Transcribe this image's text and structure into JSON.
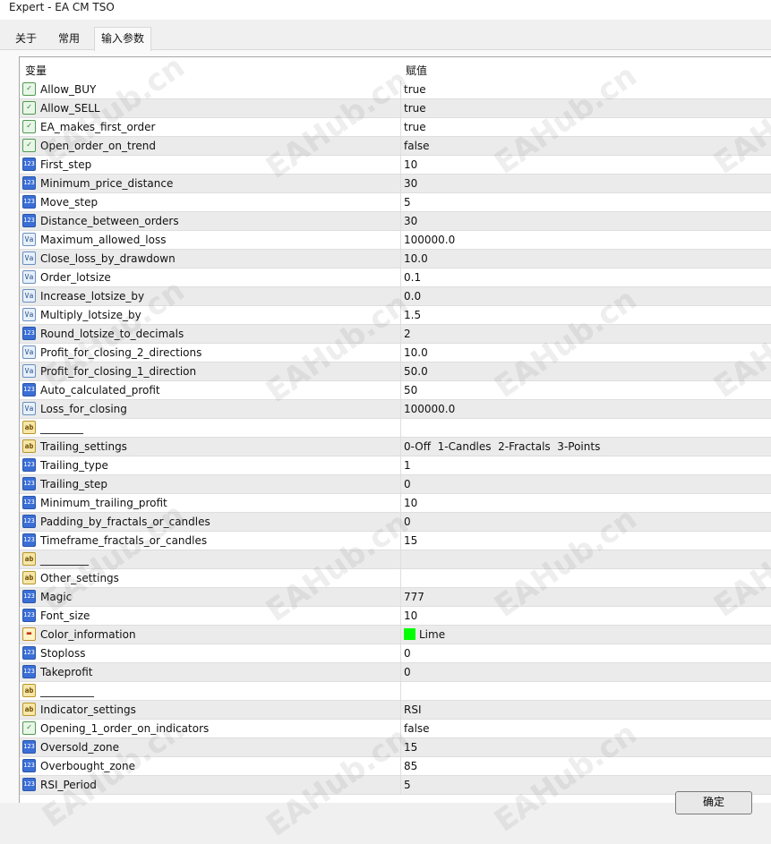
{
  "window": {
    "title": "Expert - EA CM TSO"
  },
  "tabs": [
    {
      "label": "关于",
      "active": false
    },
    {
      "label": "常用",
      "active": false
    },
    {
      "label": "输入参数",
      "active": true
    }
  ],
  "table": {
    "columns": {
      "variable": "变量",
      "value": "赋值"
    },
    "rows": [
      {
        "icon": "bool-icon",
        "type": "bool",
        "name": "Allow_BUY",
        "value": "true"
      },
      {
        "icon": "bool-icon",
        "type": "bool",
        "name": "Allow_SELL",
        "value": "true"
      },
      {
        "icon": "bool-icon",
        "type": "bool",
        "name": "EA_makes_first_order",
        "value": "true"
      },
      {
        "icon": "bool-icon",
        "type": "bool",
        "name": "Open_order_on_trend",
        "value": "false"
      },
      {
        "icon": "integer-icon",
        "type": "int",
        "name": "First_step",
        "value": "10"
      },
      {
        "icon": "integer-icon",
        "type": "int",
        "name": "Minimum_price_distance",
        "value": "30"
      },
      {
        "icon": "integer-icon",
        "type": "int",
        "name": "Move_step",
        "value": "5"
      },
      {
        "icon": "integer-icon",
        "type": "int",
        "name": "Distance_between_orders",
        "value": "30"
      },
      {
        "icon": "double-icon",
        "type": "dbl",
        "name": "Maximum_allowed_loss",
        "value": "100000.0"
      },
      {
        "icon": "double-icon",
        "type": "dbl",
        "name": "Close_loss_by_drawdown",
        "value": "10.0"
      },
      {
        "icon": "double-icon",
        "type": "dbl",
        "name": "Order_lotsize",
        "value": "0.1"
      },
      {
        "icon": "double-icon",
        "type": "dbl",
        "name": "Increase_lotsize_by",
        "value": "0.0"
      },
      {
        "icon": "double-icon",
        "type": "dbl",
        "name": "Multiply_lotsize_by",
        "value": "1.5"
      },
      {
        "icon": "integer-icon",
        "type": "int",
        "name": "Round_lotsize_to_decimals",
        "value": "2"
      },
      {
        "icon": "double-icon",
        "type": "dbl",
        "name": "Profit_for_closing_2_directions",
        "value": "10.0"
      },
      {
        "icon": "double-icon",
        "type": "dbl",
        "name": "Profit_for_closing_1_direction",
        "value": "50.0"
      },
      {
        "icon": "integer-icon",
        "type": "int",
        "name": "Auto_calculated_profit",
        "value": "50"
      },
      {
        "icon": "double-icon",
        "type": "dbl",
        "name": "Loss_for_closing",
        "value": "100000.0"
      },
      {
        "icon": "string-icon",
        "type": "str",
        "name": "________",
        "value": ""
      },
      {
        "icon": "string-icon",
        "type": "str",
        "name": "Trailing_settings",
        "value": "0-Off  1-Candles  2-Fractals  3-Points"
      },
      {
        "icon": "integer-icon",
        "type": "int",
        "name": "Trailing_type",
        "value": "1"
      },
      {
        "icon": "integer-icon",
        "type": "int",
        "name": "Trailing_step",
        "value": "0"
      },
      {
        "icon": "integer-icon",
        "type": "int",
        "name": "Minimum_trailing_profit",
        "value": "10"
      },
      {
        "icon": "integer-icon",
        "type": "int",
        "name": "Padding_by_fractals_or_candles",
        "value": "0"
      },
      {
        "icon": "integer-icon",
        "type": "int",
        "name": "Timeframe_fractals_or_candles",
        "value": "15"
      },
      {
        "icon": "string-icon",
        "type": "str",
        "name": "_________",
        "value": ""
      },
      {
        "icon": "string-icon",
        "type": "str",
        "name": "Other_settings",
        "value": ""
      },
      {
        "icon": "integer-icon",
        "type": "int",
        "name": "Magic",
        "value": "777"
      },
      {
        "icon": "integer-icon",
        "type": "int",
        "name": "Font_size",
        "value": "10"
      },
      {
        "icon": "color-icon",
        "type": "clr",
        "name": "Color_information",
        "value": "Lime",
        "swatch": "#00ff00"
      },
      {
        "icon": "integer-icon",
        "type": "int",
        "name": "Stoploss",
        "value": "0"
      },
      {
        "icon": "integer-icon",
        "type": "int",
        "name": "Takeprofit",
        "value": "0"
      },
      {
        "icon": "string-icon",
        "type": "str",
        "name": "__________",
        "value": ""
      },
      {
        "icon": "string-icon",
        "type": "str",
        "name": "Indicator_settings",
        "value": "RSI"
      },
      {
        "icon": "bool-icon",
        "type": "bool",
        "name": "Opening_1_order_on_indicators",
        "value": "false"
      },
      {
        "icon": "integer-icon",
        "type": "int",
        "name": "Oversold_zone",
        "value": "15"
      },
      {
        "icon": "integer-icon",
        "type": "int",
        "name": "Overbought_zone",
        "value": "85"
      },
      {
        "icon": "integer-icon",
        "type": "int",
        "name": "RSI_Period",
        "value": "5"
      }
    ]
  },
  "buttons": {
    "ok_label": "确定"
  },
  "watermark": {
    "text": "EAHub.cn"
  }
}
